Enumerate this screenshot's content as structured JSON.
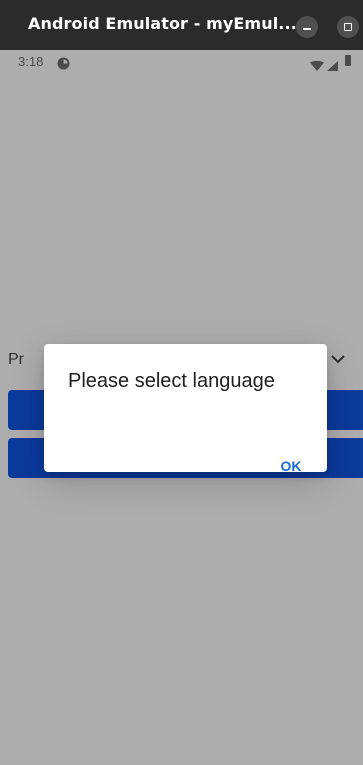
{
  "window": {
    "title": "Android Emulator - myEmul...",
    "minimize_icon": "minimize-icon",
    "maximize_icon": "maximize-icon"
  },
  "statusbar": {
    "time": "3:18",
    "icons": [
      "app-notification-icon",
      "wifi-icon",
      "signal-icon",
      "battery-icon"
    ]
  },
  "app": {
    "dropdown_label": "Pr",
    "dropdown_icon": "chevron-down-icon",
    "accent_color": "#0a3a9c",
    "buttons": [
      "",
      ""
    ]
  },
  "dialog": {
    "title": "Please select language",
    "ok_label": "OK",
    "accent_color": "#1a66d8"
  }
}
